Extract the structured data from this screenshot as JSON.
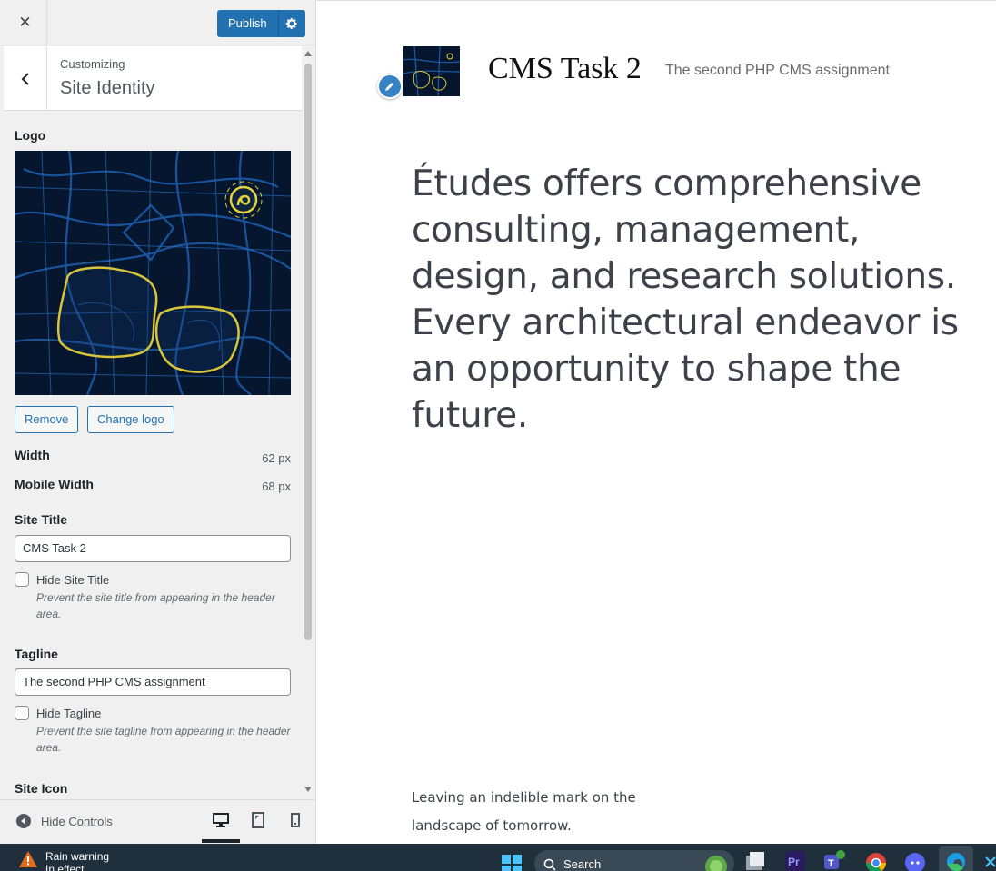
{
  "customizer": {
    "close_label": "✕",
    "publish_label": "Publish",
    "breadcrumb": "Customizing",
    "section_title": "Site Identity",
    "logo": {
      "label": "Logo",
      "remove_label": "Remove",
      "change_label": "Change logo"
    },
    "width": {
      "label": "Width",
      "value": "62 px"
    },
    "mobile_width": {
      "label": "Mobile Width",
      "value": "68 px"
    },
    "site_title": {
      "label": "Site Title",
      "value": "CMS Task 2",
      "hide_label": "Hide Site Title",
      "hide_checked": false,
      "description": "Prevent the site title from appearing in the header area."
    },
    "tagline": {
      "label": "Tagline",
      "value": "The second PHP CMS assignment",
      "hide_label": "Hide Tagline",
      "hide_checked": false,
      "description": "Prevent the site tagline from appearing in the header area."
    },
    "site_icon_label": "Site Icon",
    "footer": {
      "hide_controls_label": "Hide Controls",
      "devices": [
        "desktop-icon",
        "tablet-icon",
        "mobile-icon"
      ],
      "active_device": "desktop"
    },
    "accent_color": "#2271b1"
  },
  "preview": {
    "site_title": "CMS Task 2",
    "tagline": "The second PHP CMS assignment",
    "hero_text": "Études offers comprehensive consulting, management, design, and research solutions. Every architectural endeavor is an opportunity to shape the future.",
    "footer_text": "Leaving an indelible mark on the landscape of tomorrow."
  },
  "taskbar": {
    "weather_title": "Rain warning",
    "weather_subtitle": "In effect",
    "search_label": "Search",
    "apps": [
      "windows-start-icon",
      "search-icon",
      "file-explorer-icon",
      "premiere-icon",
      "teams-icon",
      "chrome-icon",
      "discord-icon",
      "edge-icon"
    ]
  }
}
